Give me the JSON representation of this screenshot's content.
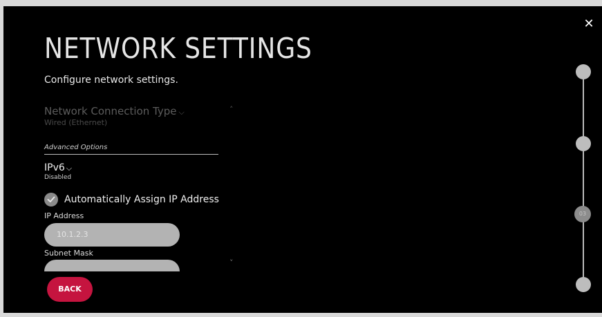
{
  "header": {
    "title": "NETWORK SETTINGS",
    "subtitle": "Configure network settings.",
    "close_icon": "✕"
  },
  "connection_type": {
    "label": "Network Connection Type",
    "value": "Wired (Ethernet)",
    "chevron": "⌵"
  },
  "scroll": {
    "up_icon": "˄",
    "down_icon": "˅"
  },
  "advanced": {
    "label": "Advanced Options"
  },
  "ipv6": {
    "label": "IPv6",
    "value": "Disabled",
    "chevron": "⌵"
  },
  "auto_assign": {
    "label": "Automatically Assign IP Address",
    "checked": true,
    "check_color": "#8a8a8a"
  },
  "fields": {
    "ip_address": {
      "label": "IP Address",
      "value": "10.1.2.3"
    },
    "subnet_mask": {
      "label": "Subnet Mask",
      "value": ""
    }
  },
  "footer": {
    "back_label": "BACK",
    "back_color": "#c5143f"
  },
  "stepper": {
    "current_label": "03"
  }
}
